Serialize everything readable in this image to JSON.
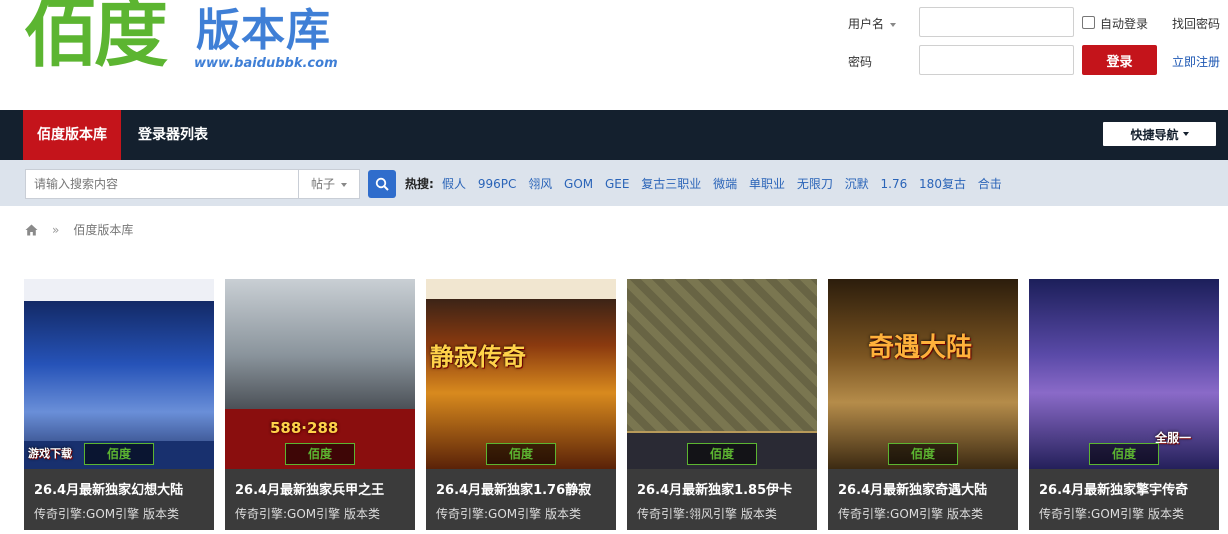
{
  "logo": {
    "big": "佰度",
    "small": "版本库",
    "url": "www.baidubbk.com"
  },
  "login": {
    "username_label": "用户名",
    "password_label": "密码",
    "auto_login": "自动登录",
    "forgot": "找回密码",
    "login_button": "登录",
    "register": "立即注册"
  },
  "nav": {
    "items": [
      {
        "label": "佰度版本库",
        "active": true
      },
      {
        "label": "登录器列表",
        "active": false
      }
    ],
    "quick_nav": "快捷导航"
  },
  "search": {
    "placeholder": "请输入搜索内容",
    "type": "帖子",
    "hot_label": "热搜:",
    "hot_terms": [
      "假人",
      "996PC",
      "翎风",
      "GOM",
      "GEE",
      "复古三职业",
      "微端",
      "单职业",
      "无限刀",
      "沉默",
      "1.76",
      "180复古",
      "合击"
    ]
  },
  "breadcrumb": {
    "current": "佰度版本库"
  },
  "cards": [
    {
      "title": "26.4月最新独家幻想大陆",
      "meta": "传奇引擎:GOM引擎 版本类",
      "img_text": "游戏下载",
      "bg": "#1a3a8a"
    },
    {
      "title": "26.4月最新独家兵甲之王",
      "meta": "传奇引擎:GOM引擎 版本类",
      "img_text": "588·288",
      "bg": "#7b8790"
    },
    {
      "title": "26.4月最新独家1.76静寂",
      "meta": "传奇引擎:GOM引擎 版本类",
      "img_text": "静寂传奇",
      "bg": "#7a3b12"
    },
    {
      "title": "26.4月最新独家1.85伊卡",
      "meta": "传奇引擎:翎风引擎 版本类",
      "img_text": "",
      "bg": "#6b6a4a"
    },
    {
      "title": "26.4月最新独家奇遇大陆",
      "meta": "传奇引擎:GOM引擎 版本类",
      "img_text": "奇遇大陆",
      "bg": "#4a3418"
    },
    {
      "title": "26.4月最新独家擎宇传奇",
      "meta": "传奇引擎:GOM引擎 版本类",
      "img_text": "全服一",
      "bg": "#3a3c8a"
    }
  ],
  "card_badge": "佰度"
}
